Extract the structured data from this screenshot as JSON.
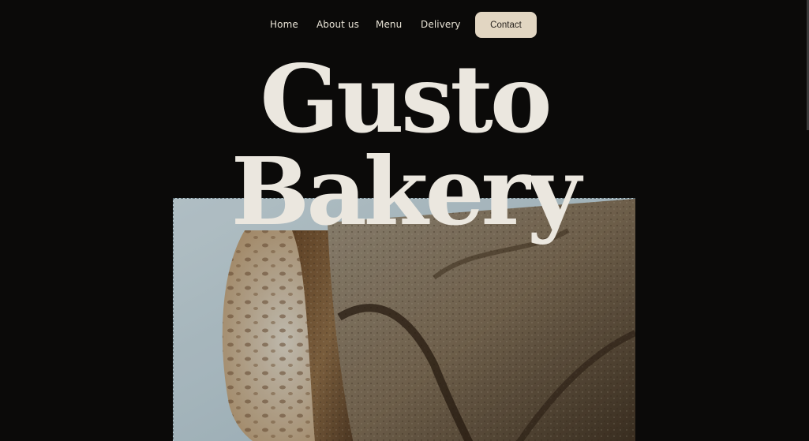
{
  "nav": {
    "home": "Home",
    "about": "About us",
    "menu": "Menu",
    "delivery": "Delivery",
    "contact": "Contact"
  },
  "hero": {
    "title_line1": "Gusto",
    "title_line2": "Bakery"
  },
  "colors": {
    "background": "#0b0a09",
    "title": "#ebe7df",
    "nav_text": "#e8e3d6",
    "contact_button": "#e2d6c2"
  }
}
